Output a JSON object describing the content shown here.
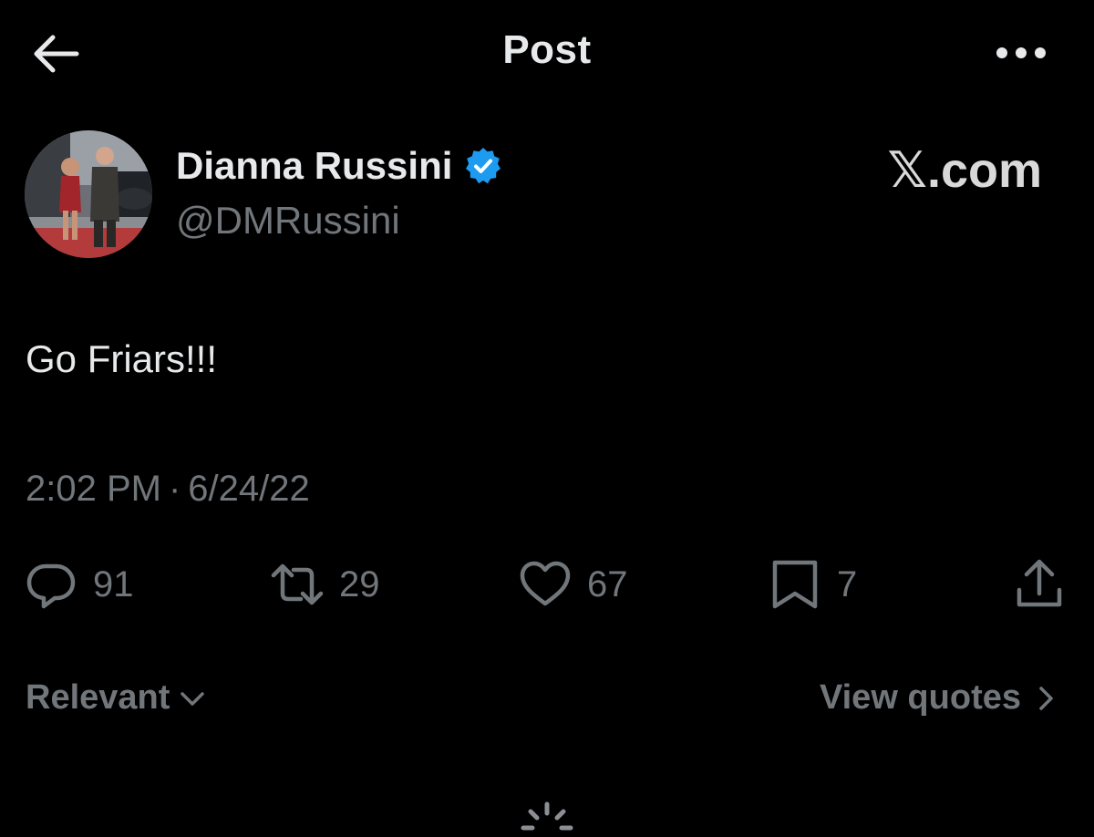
{
  "topbar": {
    "title": "Post"
  },
  "author": {
    "name": "Dianna Russini",
    "handle": "@DMRussini",
    "verified_color": "#1d9bf0"
  },
  "watermark": "𝕏.com",
  "post": {
    "text": "Go Friars!!!",
    "time": "2:02 PM",
    "separator": "·",
    "date": "6/24/22"
  },
  "actions": {
    "replies": "91",
    "reposts": "29",
    "likes": "67",
    "bookmarks": "7"
  },
  "controls": {
    "sort_label": "Relevant",
    "view_quotes_label": "View quotes"
  },
  "icons": {
    "back": "arrow-left-icon",
    "more": "more-horizontal-icon",
    "verified": "verified-badge-icon",
    "reply": "reply-icon",
    "repost": "repost-icon",
    "like": "heart-icon",
    "bookmark": "bookmark-icon",
    "share": "share-icon",
    "sort": "chevron-down-icon",
    "view_quotes": "chevron-right-icon",
    "loading": "spinner-icon"
  }
}
